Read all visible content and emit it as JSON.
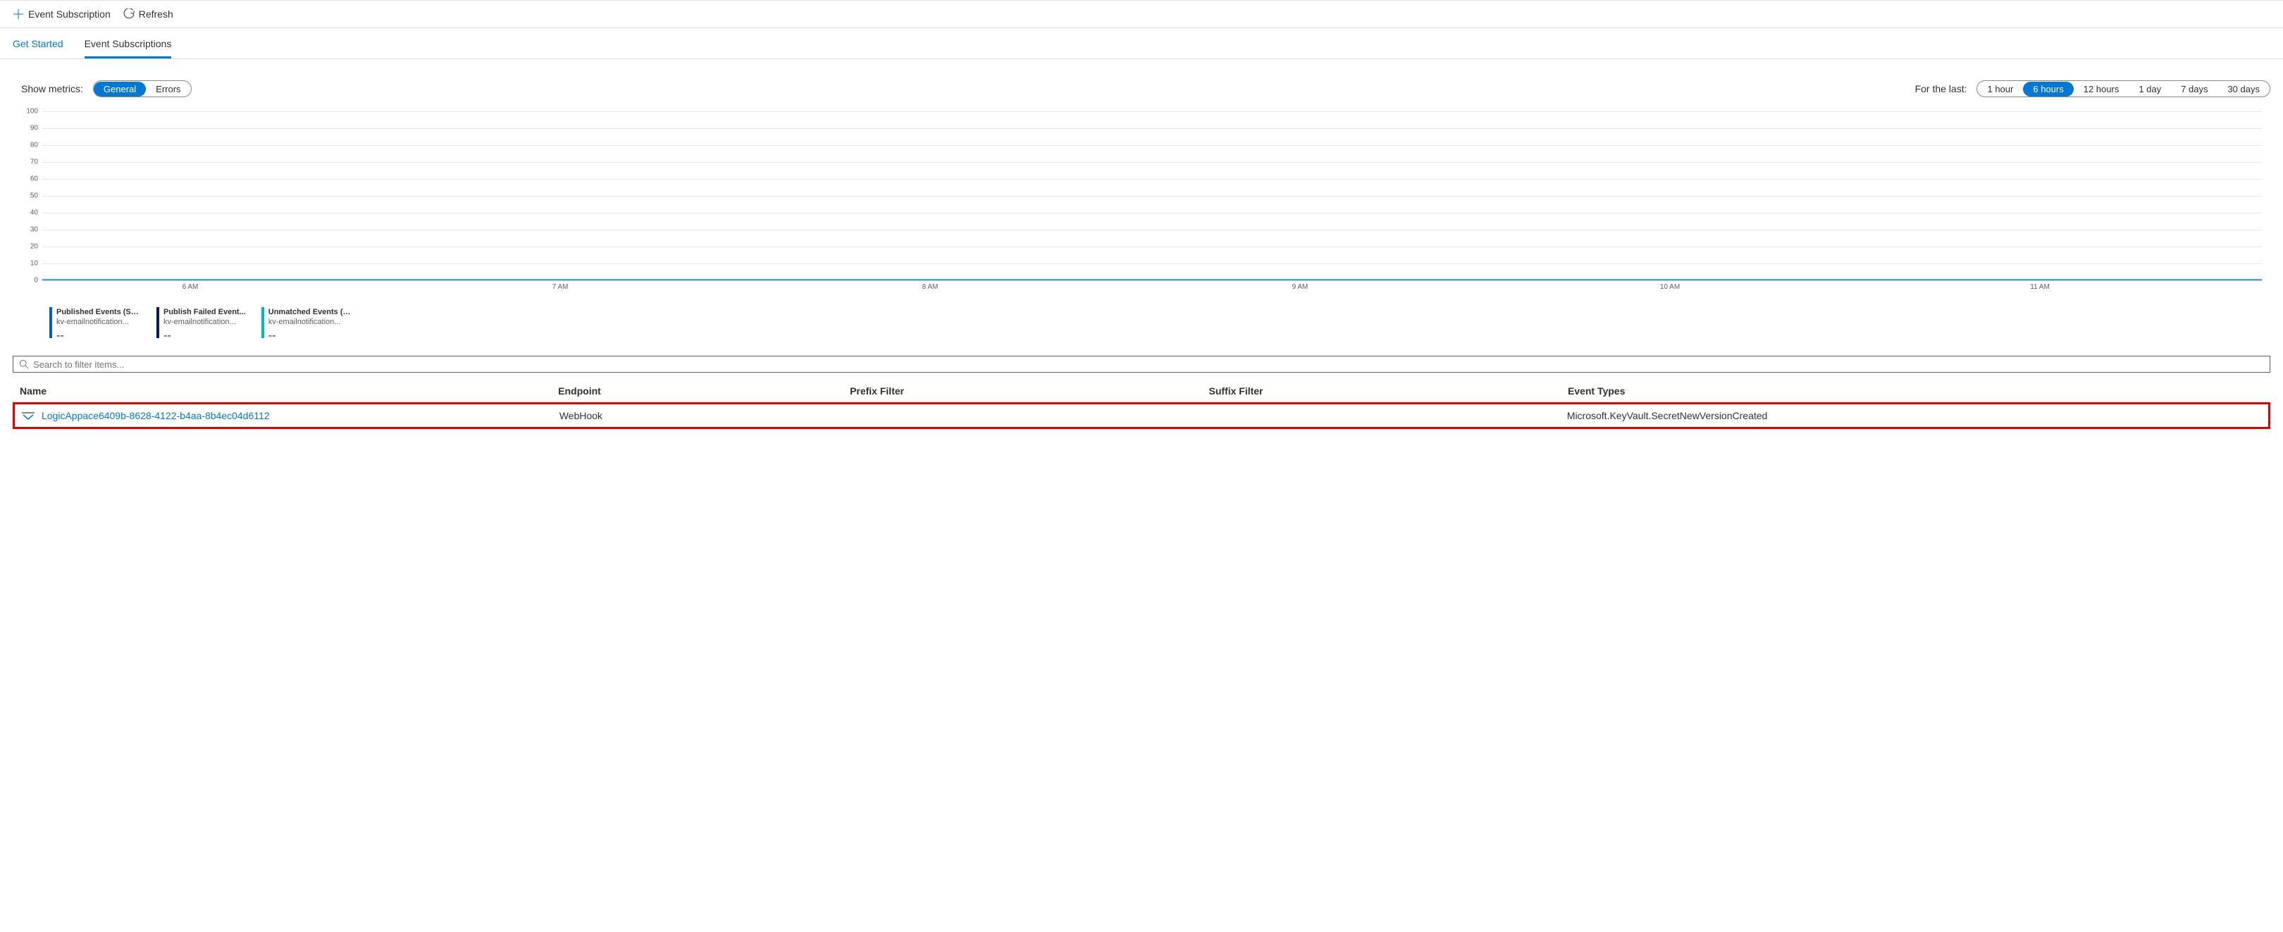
{
  "toolbar": {
    "add_label": "Event Subscription",
    "refresh_label": "Refresh"
  },
  "tabs": {
    "get_started": "Get Started",
    "event_subs": "Event Subscriptions"
  },
  "filters": {
    "metrics_label": "Show metrics:",
    "metrics_options": [
      "General",
      "Errors"
    ],
    "metrics_selected": "General",
    "time_label": "For the last:",
    "time_options": [
      "1 hour",
      "6 hours",
      "12 hours",
      "1 day",
      "7 days",
      "30 days"
    ],
    "time_selected": "6 hours"
  },
  "chart_data": {
    "type": "line",
    "ylim": [
      0,
      100
    ],
    "y_ticks": [
      0,
      10,
      20,
      30,
      40,
      50,
      60,
      70,
      80,
      90,
      100
    ],
    "x_ticks": [
      "6 AM",
      "7 AM",
      "8 AM",
      "9 AM",
      "10 AM",
      "11 AM"
    ],
    "series": [
      {
        "name": "Published Events (Sum)",
        "source": "kv-emailnotification...",
        "color": "#0062b1",
        "value_display": "--",
        "values": [
          0,
          0,
          0,
          0,
          0,
          0
        ]
      },
      {
        "name": "Publish Failed Event...",
        "source": "kv-emailnotification...",
        "color": "#002050",
        "value_display": "--",
        "values": [
          0,
          0,
          0,
          0,
          0,
          0
        ]
      },
      {
        "name": "Unmatched Events (Sum)",
        "source": "kv-emailnotification...",
        "color": "#00b7c3",
        "value_display": "--",
        "values": [
          0,
          0,
          0,
          0,
          0,
          0
        ]
      }
    ]
  },
  "search": {
    "placeholder": "Search to filter items..."
  },
  "table": {
    "headers": {
      "name": "Name",
      "endpoint": "Endpoint",
      "prefix": "Prefix Filter",
      "suffix": "Suffix Filter",
      "types": "Event Types"
    },
    "rows": [
      {
        "name": "LogicAppace6409b-8628-4122-b4aa-8b4ec04d6112",
        "endpoint": "WebHook",
        "prefix": "",
        "suffix": "",
        "types": "Microsoft.KeyVault.SecretNewVersionCreated"
      }
    ]
  }
}
